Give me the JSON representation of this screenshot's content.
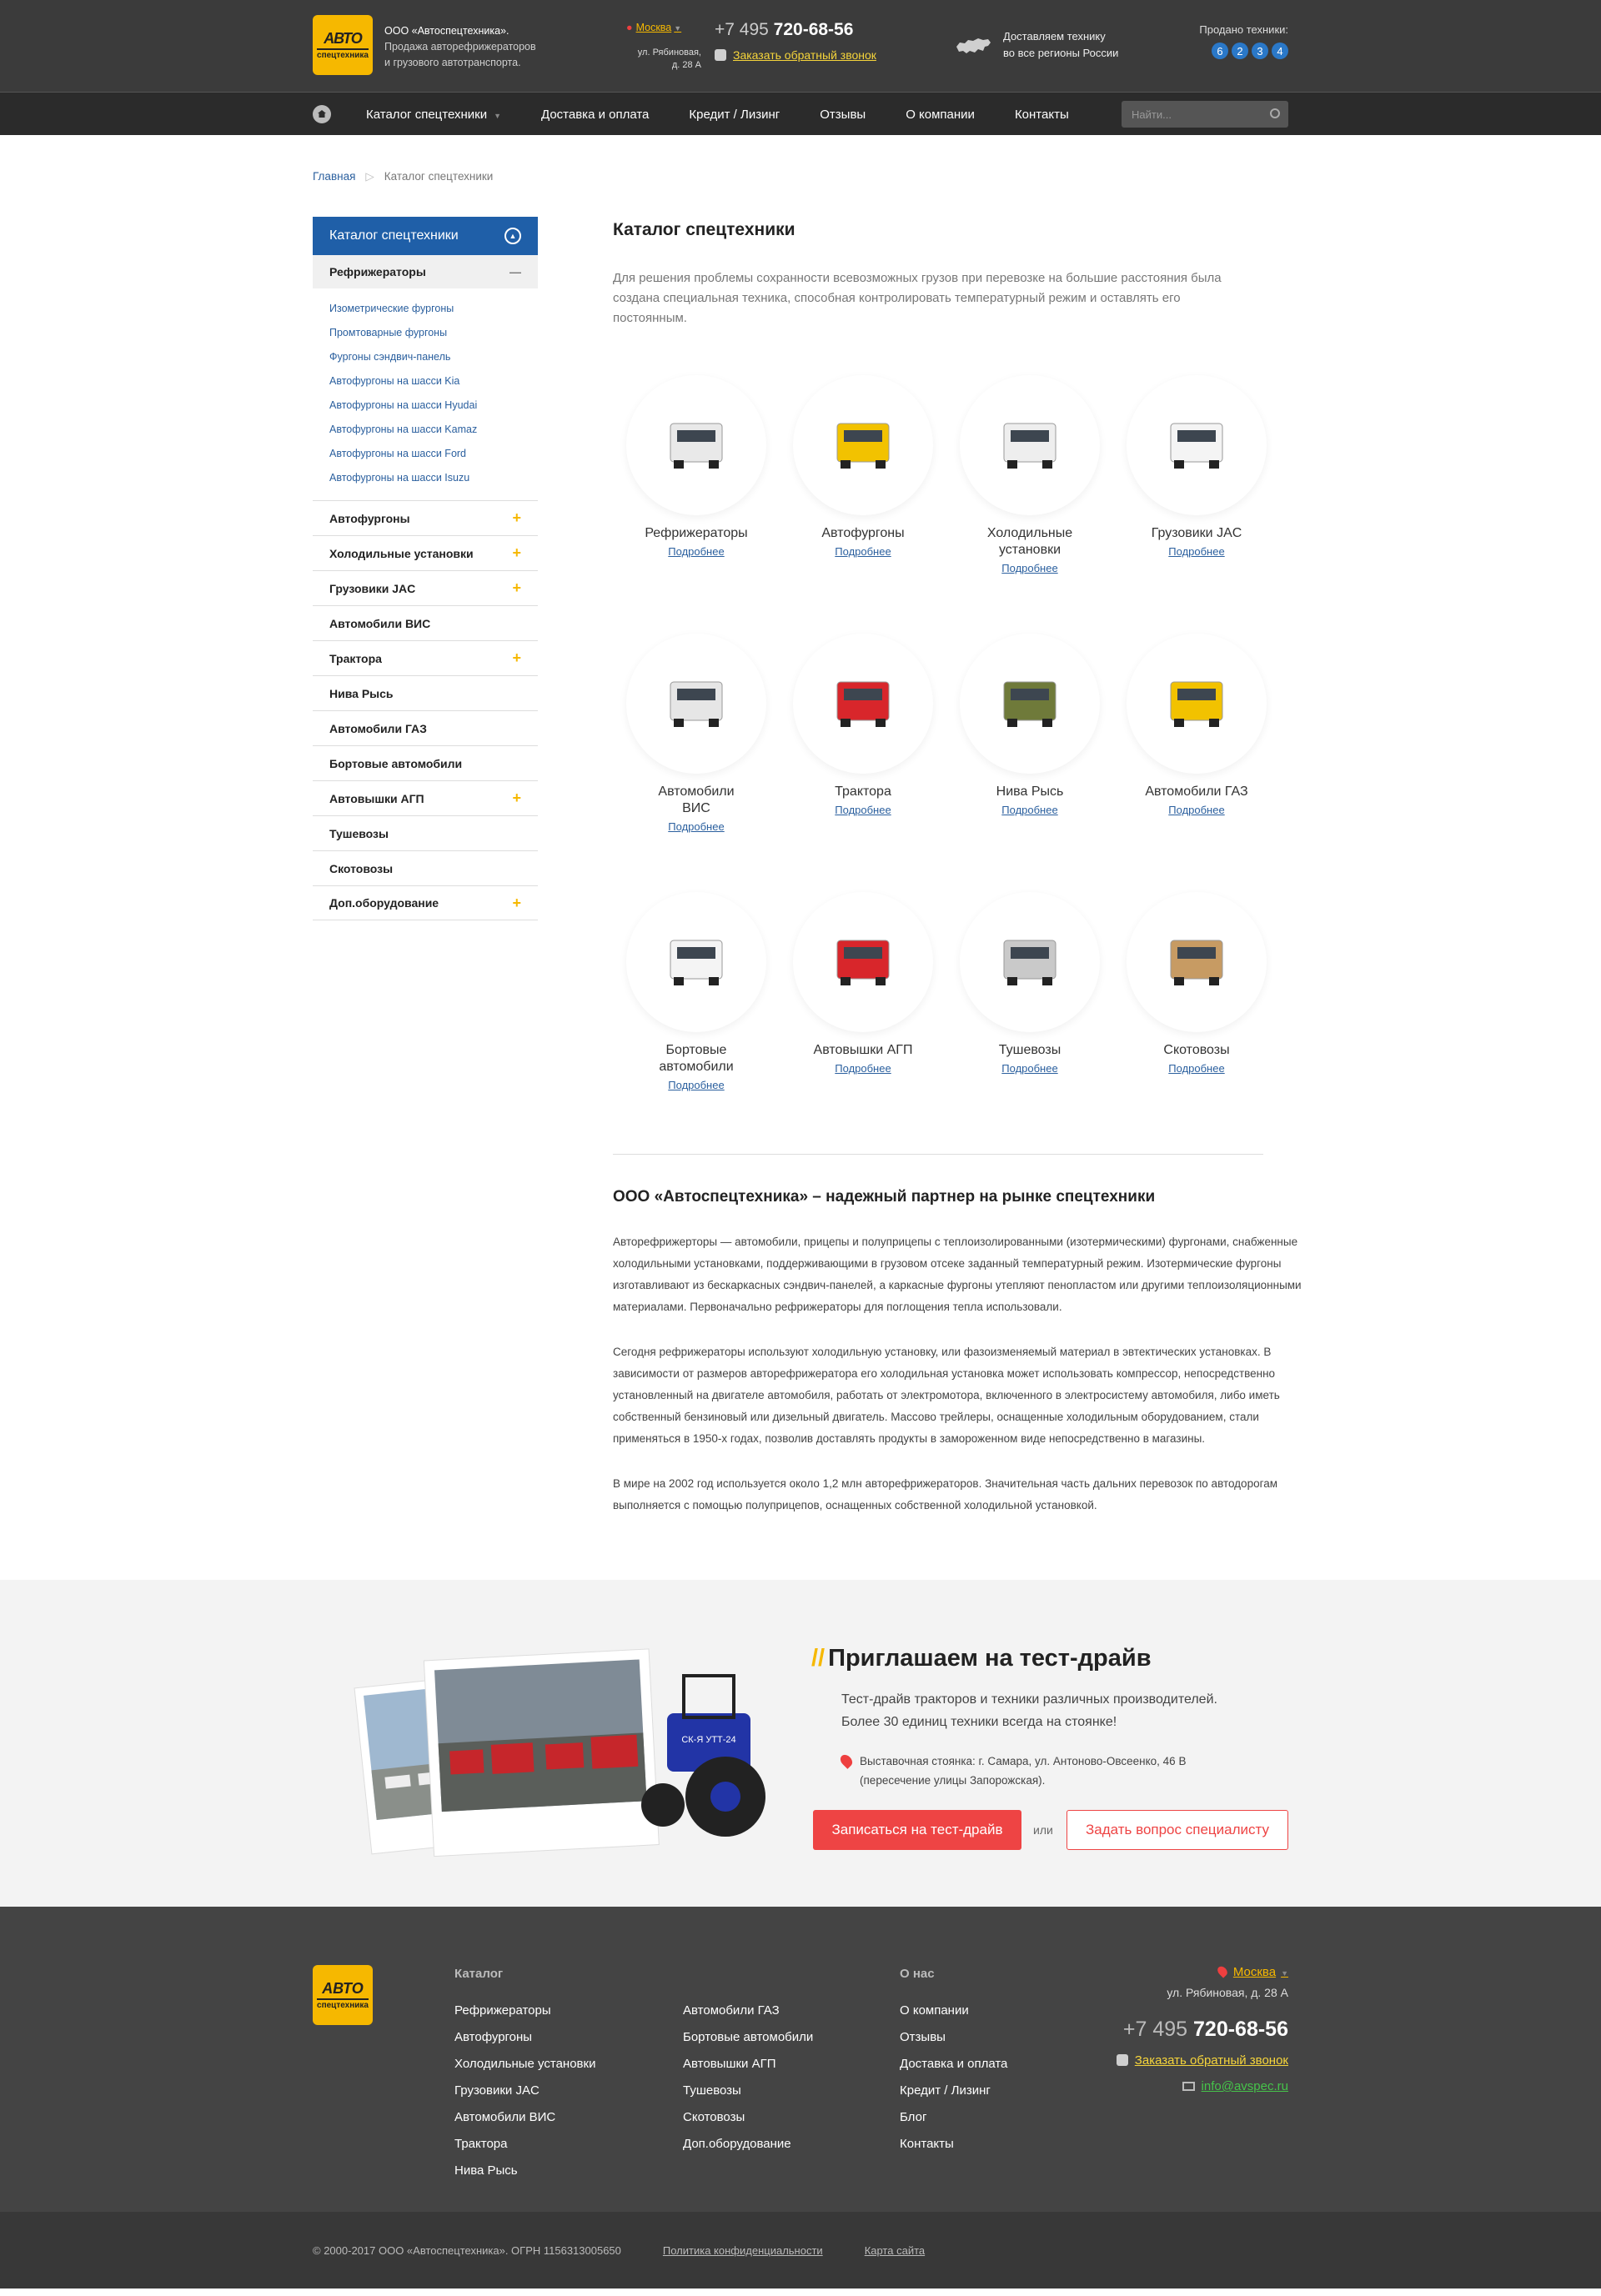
{
  "header": {
    "logo_top": "АВТО",
    "logo_bottom": "спецтехника",
    "company_name": "ООО «Автоспецтехника».",
    "company_desc_1": "Продажа авторефрижераторов",
    "company_desc_2": "и грузового автотранспорта.",
    "city": "Москва",
    "address_1": "ул. Рябиновая,",
    "address_2": "д. 28 А",
    "phone_code": "+7 495",
    "phone_number": "720-68-56",
    "callback": "Заказать обратный звонок",
    "delivery_1": "Доставляем технику",
    "delivery_2": "во все регионы России",
    "sold_label": "Продано техники:",
    "sold_digits": [
      "6",
      "2",
      "3",
      "4"
    ]
  },
  "nav": {
    "items": [
      "Каталог спецтехники",
      "Доставка и оплата",
      "Кредит / Лизинг",
      "Отзывы",
      "О компании",
      "Контакты"
    ],
    "search_placeholder": "Найти..."
  },
  "breadcrumb": {
    "home": "Главная",
    "current": "Каталог спецтехники"
  },
  "sidebar": {
    "title": "Каталог спецтехники",
    "active": "Рефрижераторы",
    "sublinks": [
      "Изометрические фургоны",
      "Промтоварные фургоны",
      "Фургоны сэндвич-панель",
      "Автофургоны на шасси Kia",
      "Автофургоны на шасси Hyudai",
      "Автофургоны на шасси Kamaz",
      "Автофургоны на шасси Ford",
      "Автофургоны на шасси Isuzu"
    ],
    "items": [
      {
        "label": "Автофургоны",
        "expand": "+"
      },
      {
        "label": "Холодильные установки",
        "expand": "+"
      },
      {
        "label": "Грузовики JAC",
        "expand": "+"
      },
      {
        "label": "Автомобили ВИС",
        "expand": ""
      },
      {
        "label": "Трактора",
        "expand": "+"
      },
      {
        "label": "Нива Рысь",
        "expand": ""
      },
      {
        "label": "Автомобили ГАЗ",
        "expand": ""
      },
      {
        "label": "Бортовые автомобили",
        "expand": ""
      },
      {
        "label": "Автовышки АГП",
        "expand": "+"
      },
      {
        "label": "Тушевозы",
        "expand": ""
      },
      {
        "label": "Скотовозы",
        "expand": ""
      },
      {
        "label": "Доп.оборудование",
        "expand": "+"
      }
    ]
  },
  "main": {
    "title": "Каталог спецтехники",
    "intro": "Для решения проблемы сохранности всевозможных грузов при перевозке на большие расстояния была создана специальная техника, способная контролировать температурный режим и оставлять его постоянным.",
    "more_label": "Подробнее",
    "products": [
      {
        "title": "Рефрижераторы",
        "icon": "reefer-van-icon",
        "color": "#e9e9e9"
      },
      {
        "title": "Автофургоны",
        "icon": "yellow-van-icon",
        "color": "#f2c200"
      },
      {
        "title": "Холодильные установки",
        "icon": "refrigeration-unit-icon",
        "color": "#eeeeee"
      },
      {
        "title": "Грузовики JAC",
        "icon": "box-truck-icon",
        "color": "#f4f4f4"
      },
      {
        "title": "Автомобили ВИС",
        "icon": "vis-van-icon",
        "color": "#e6e6e6"
      },
      {
        "title": "Трактора",
        "icon": "tractor-icon",
        "color": "#d8262b"
      },
      {
        "title": "Нива Рысь",
        "icon": "niva-icon",
        "color": "#6f7a3a"
      },
      {
        "title": "Автомобили ГАЗ",
        "icon": "gazelle-icon",
        "color": "#f2c200"
      },
      {
        "title": "Бортовые автомобили",
        "icon": "flatbed-truck-icon",
        "color": "#f4f4f4"
      },
      {
        "title": "Автовышки АГП",
        "icon": "aerial-platform-icon",
        "color": "#d8262b"
      },
      {
        "title": "Тушевозы",
        "icon": "carcass-van-icon",
        "color": "#c9c9c9"
      },
      {
        "title": "Скотовозы",
        "icon": "livestock-van-icon",
        "color": "#c79b63"
      }
    ],
    "article_title": "ООО «Автоспецтехника» – надежный партнер на рынке спецтехники",
    "paragraphs": [
      "Авторефрижерторы — автомобили, прицепы и полуприцепы с теплоизолированными (изотермическими) фургонами, снабженные холодильными установками, поддерживающими в грузовом отсеке заданный температурный режим. Изотермические фургоны изготавливают из бескаркасных сэндвич-панелей, а каркасные фургоны утепляют пенопластом или другими теплоизоляционными материалами. Первоначально рефрижераторы для поглощения тепла использовали.",
      "Сегодня рефрижераторы используют холодильную установку, или фазоизменяемый материал в эвтектических установках. В зависимости от размеров авторефрижератора его холодильная установка может использовать компрессор, непосредственно установленный на двигателе автомобиля, работать от электромотора, включенного в электросистему автомобиля, либо иметь собственный бензиновый или дизельный двигатель. Массово трейлеры, оснащенные холодильным оборудованием, стали применяться в 1950-х годах, позволив доставлять продукты в замороженном виде непосредственно в магазины.",
      "В мире на 2002 год используется около 1,2 млн авторефрижераторов. Значительная часть дальних перевозок по автодорогам выполняется с помощью полуприцепов, оснащенных собственной холодильной установкой."
    ]
  },
  "testdrive": {
    "slashes": "//",
    "title": "Приглашаем на тест-драйв",
    "text_1": "Тест-драйв тракторов и техники различных производителей.",
    "text_2": "Более 30 единиц техники всегда на стоянке!",
    "address_1": "Выставочная стоянка: г. Самара, ул. Антоново-Овсеенко, 46 В",
    "address_2": "(пересечение улицы Запорожская).",
    "btn_primary": "Записаться на тест-драйв",
    "or": "или",
    "btn_secondary": "Задать вопрос специалисту",
    "tractor_label": "СК-Я УТТ-24"
  },
  "footer": {
    "catalog_title": "Каталог",
    "catalog_col1": [
      "Рефрижераторы",
      "Автофургоны",
      "Холодильные установки",
      "Грузовики JAC",
      "Автомобили ВИС",
      "Трактора",
      "Нива Рысь"
    ],
    "catalog_col2": [
      "Автомобили ГАЗ",
      "Бортовые автомобили",
      "Автовышки АГП",
      "Тушевозы",
      "Скотовозы",
      "Доп.оборудование"
    ],
    "about_title": "О нас",
    "about_links": [
      "О компании",
      "Отзывы",
      "Доставка и оплата",
      "Кредит / Лизинг",
      "Блог",
      "Контакты"
    ],
    "city": "Москва",
    "address": "ул. Рябиновая, д. 28 А",
    "phone_code": "+7 495",
    "phone_number": "720-68-56",
    "callback": "Заказать обратный звонок",
    "email": "info@avspec.ru"
  },
  "bottom": {
    "copyright": "© 2000-2017 ООО «Автоспецтехника». ОГРН 1156313005650",
    "privacy": "Политика конфиденциальности",
    "sitemap": "Карта сайта"
  }
}
